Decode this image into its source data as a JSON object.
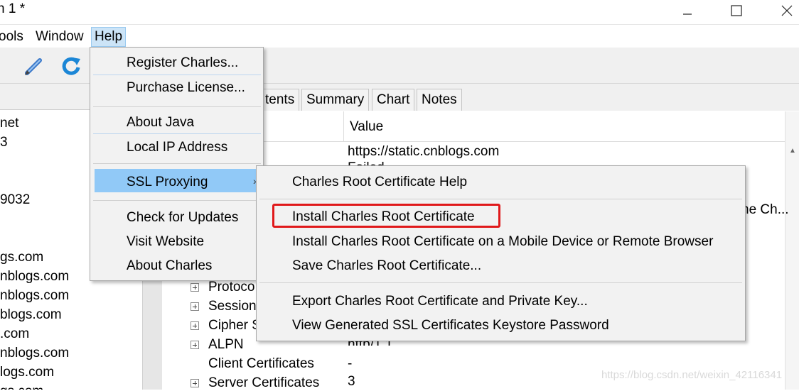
{
  "window": {
    "title": "n 1 *",
    "controls": {
      "minimize": "—",
      "maximize": "☐",
      "close": "✕"
    }
  },
  "menubar": {
    "tools": "ools",
    "window": "Window",
    "help": "Help"
  },
  "toolbar": {
    "icons": [
      "pen-icon",
      "refresh-icon"
    ]
  },
  "left_panel": {
    "items": [
      "net",
      "3",
      "9032",
      "gs.com",
      "nblogs.com",
      "nblogs.com",
      "blogs.com",
      ".com",
      "nblogs.com",
      "logs.com",
      "gs.com"
    ]
  },
  "right_panel": {
    "tabs": [
      "tents",
      "Summary",
      "Chart",
      "Notes"
    ],
    "value_header": "Value",
    "values": {
      "url": "https://static.cnblogs.com",
      "partial": "Failed",
      "right_clip": "he Ch...",
      "alpn_value": "http/1.1",
      "client_certs_value": "-",
      "server_certs_value": "3"
    },
    "tree_rows": [
      {
        "label": "Protoco",
        "expandable": true
      },
      {
        "label": "Session",
        "expandable": true
      },
      {
        "label": "Cipher S",
        "expandable": true
      },
      {
        "label": "ALPN",
        "expandable": true
      },
      {
        "label": "Client Certificates",
        "expandable": false
      },
      {
        "label": "Server Certificates",
        "expandable": true
      }
    ]
  },
  "help_menu": {
    "items": [
      "Register Charles...",
      "Purchase License...",
      "About Java",
      "Local IP Address",
      "SSL Proxying",
      "Check for Updates",
      "Visit Website",
      "About Charles"
    ],
    "submenu_arrow": "›"
  },
  "ssl_submenu": {
    "items": [
      "Charles Root Certificate Help",
      "Install Charles Root Certificate",
      "Install Charles Root Certificate on a Mobile Device or Remote Browser",
      "Save Charles Root Certificate...",
      "Export Charles Root Certificate and Private Key...",
      "View Generated SSL Certificates Keystore Password"
    ],
    "highlighted": "Install Charles Root Certificate"
  },
  "watermark": "https://blog.csdn.net/weixin_42116341",
  "colors": {
    "menu_highlight": "#91c9f7",
    "annotation_box": "#e0191b",
    "menubar_active": "#cce4f7"
  }
}
